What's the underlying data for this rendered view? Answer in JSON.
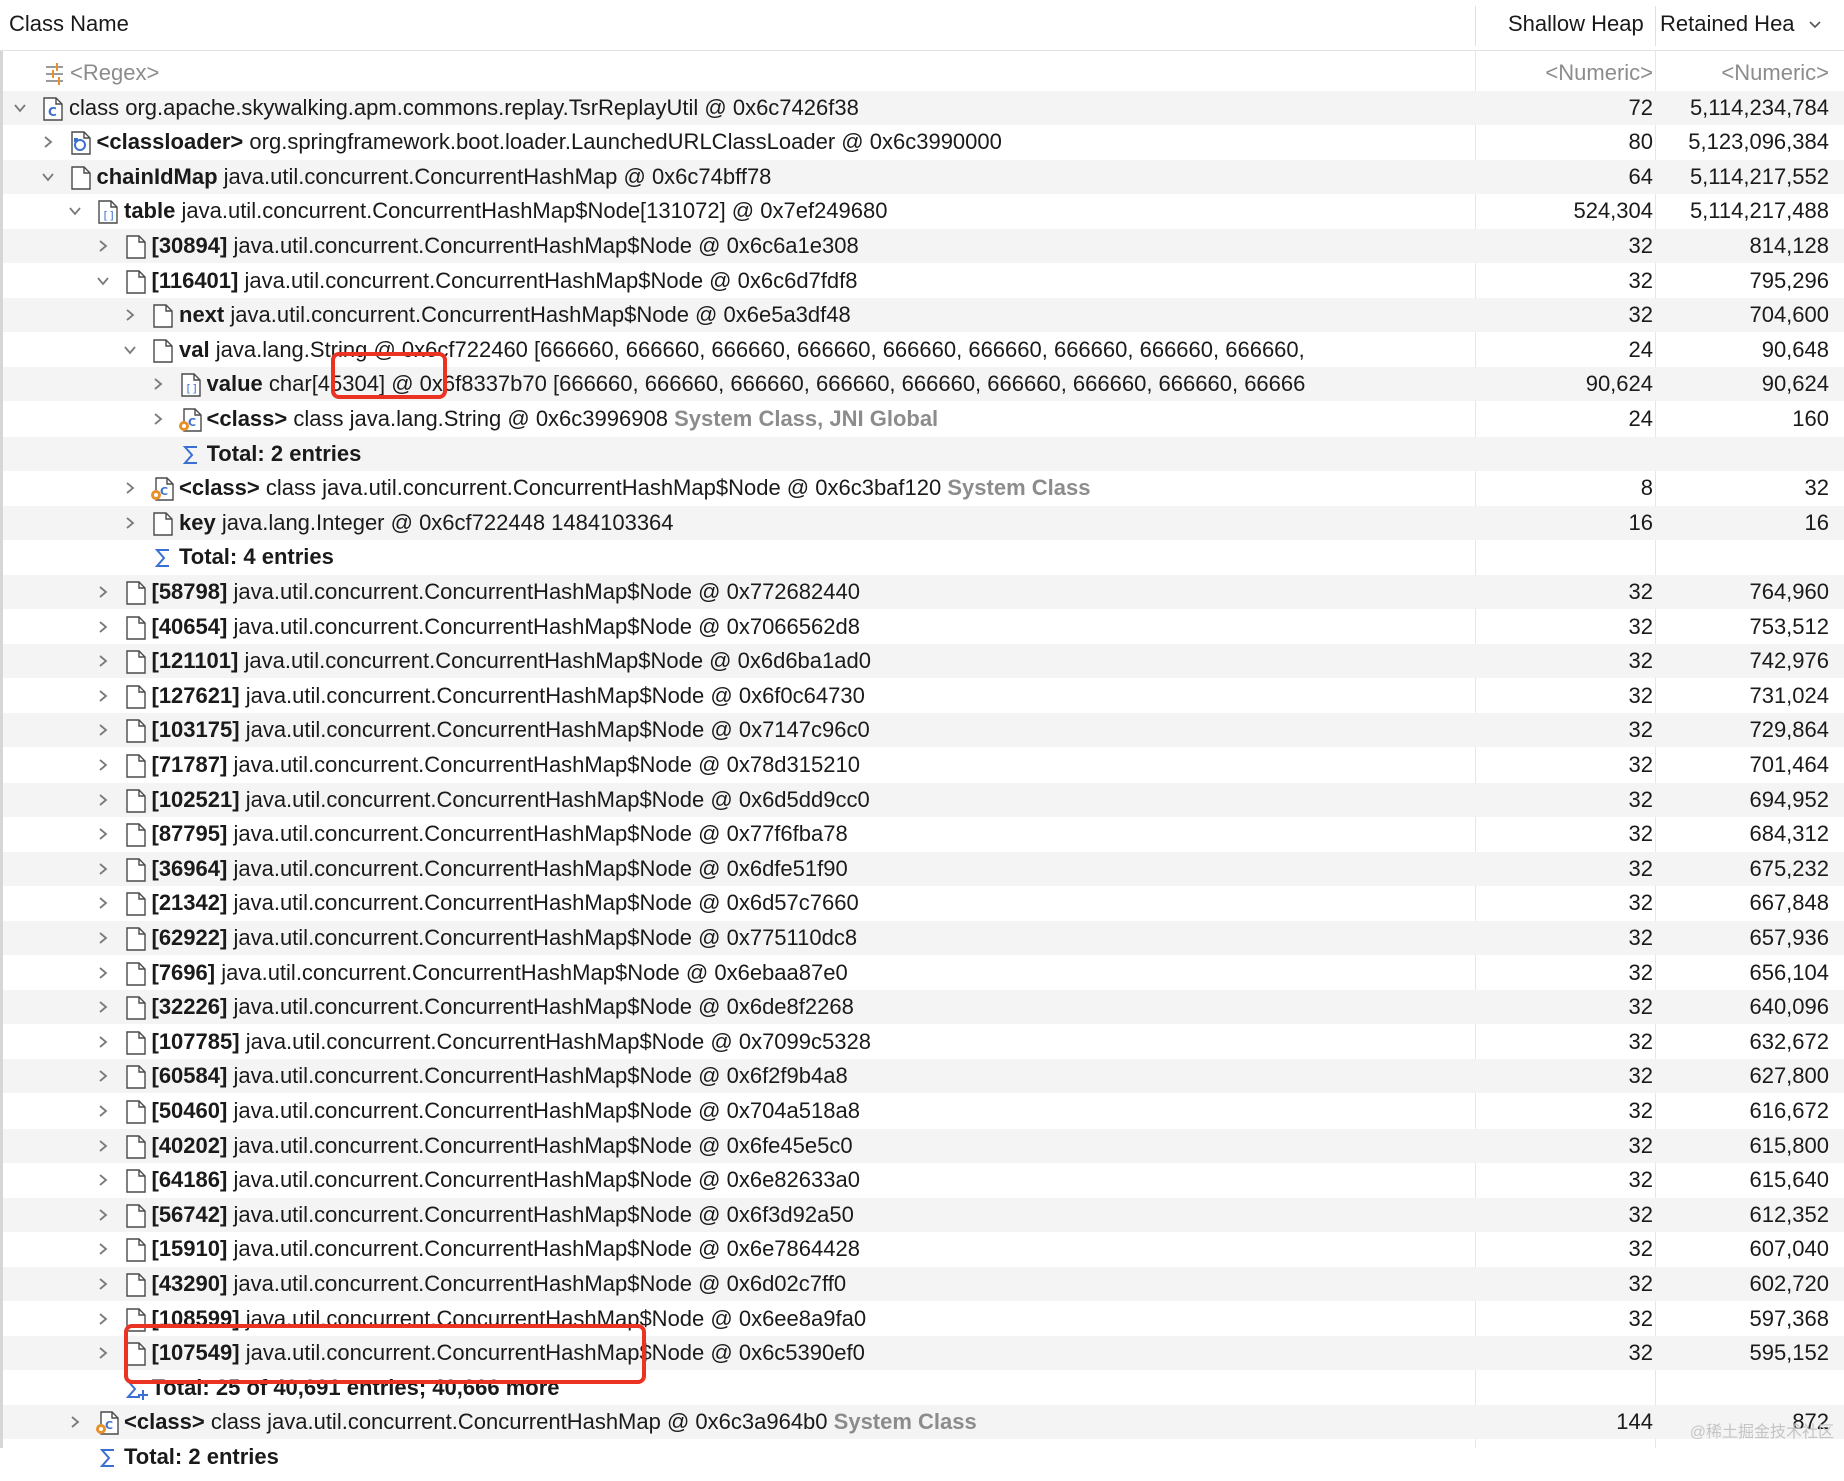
{
  "header": {
    "col_class": "Class Name",
    "col_shallow": "Shallow Heap",
    "col_retained": "Retained Hea"
  },
  "rows": [
    {
      "type": "regex",
      "text": "<Regex>",
      "shallow": "<Numeric>",
      "retained": "<Numeric>"
    },
    {
      "indent": 0,
      "twisty": "down",
      "icon": "class",
      "bold": "",
      "text": "class org.apache.skywalking.apm.commons.replay.TsrReplayUtil @ 0x6c7426f38",
      "gray": "",
      "shallow": "72",
      "retained": "5,114,234,784"
    },
    {
      "indent": 1,
      "twisty": "right",
      "icon": "classloader",
      "bold": "<classloader>",
      "text": "org.springframework.boot.loader.LaunchedURLClassLoader @ 0x6c3990000",
      "gray": "",
      "shallow": "80",
      "retained": "5,123,096,384"
    },
    {
      "indent": 1,
      "twisty": "down",
      "icon": "object",
      "bold": "chainIdMap",
      "text": "java.util.concurrent.ConcurrentHashMap @ 0x6c74bff78",
      "gray": "",
      "shallow": "64",
      "retained": "5,114,217,552"
    },
    {
      "indent": 2,
      "twisty": "down",
      "icon": "array",
      "bold": "table",
      "text": "java.util.concurrent.ConcurrentHashMap$Node[131072] @ 0x7ef249680",
      "gray": "",
      "shallow": "524,304",
      "retained": "5,114,217,488"
    },
    {
      "indent": 3,
      "twisty": "right",
      "icon": "object",
      "bold": "[30894]",
      "text": "java.util.concurrent.ConcurrentHashMap$Node @ 0x6c6a1e308",
      "gray": "",
      "shallow": "32",
      "retained": "814,128"
    },
    {
      "indent": 3,
      "twisty": "down",
      "icon": "object",
      "bold": "[116401]",
      "text": "java.util.concurrent.ConcurrentHashMap$Node @ 0x6c6d7fdf8",
      "gray": "",
      "shallow": "32",
      "retained": "795,296"
    },
    {
      "indent": 4,
      "twisty": "right",
      "icon": "object",
      "bold": "next",
      "text": "java.util.concurrent.ConcurrentHashMap$Node @ 0x6e5a3df48",
      "gray": "",
      "shallow": "32",
      "retained": "704,600"
    },
    {
      "indent": 4,
      "twisty": "down",
      "icon": "object",
      "bold": "val",
      "text": "java.lang.String @ 0x6cf722460  [666660, 666660, 666660, 666660, 666660, 666660, 666660, 666660, 666660,",
      "gray": "",
      "shallow": "24",
      "retained": "90,648"
    },
    {
      "indent": 5,
      "twisty": "right",
      "icon": "array",
      "bold": "value",
      "text": "char[45304] @ 0x6f8337b70  [666660, 666660, 666660, 666660, 666660, 666660, 666660, 666660, 66666",
      "gray": "",
      "shallow": "90,624",
      "retained": "90,624"
    },
    {
      "indent": 5,
      "twisty": "right",
      "icon": "sysclass",
      "bold": "<class>",
      "text": "class java.lang.String @ 0x6c3996908",
      "gray": "System Class, JNI Global",
      "shallow": "24",
      "retained": "160"
    },
    {
      "indent": 5,
      "twisty": "none",
      "icon": "sigma",
      "bold": "Total: 2 entries",
      "text": "",
      "gray": "",
      "shallow": "",
      "retained": ""
    },
    {
      "indent": 4,
      "twisty": "right",
      "icon": "sysclass",
      "bold": "<class>",
      "text": "class java.util.concurrent.ConcurrentHashMap$Node @ 0x6c3baf120",
      "gray": "System Class",
      "shallow": "8",
      "retained": "32"
    },
    {
      "indent": 4,
      "twisty": "right",
      "icon": "object",
      "bold": "key",
      "text": "java.lang.Integer @ 0x6cf722448  1484103364",
      "gray": "",
      "shallow": "16",
      "retained": "16"
    },
    {
      "indent": 4,
      "twisty": "none",
      "icon": "sigma",
      "bold": "Total: 4 entries",
      "text": "",
      "gray": "",
      "shallow": "",
      "retained": ""
    },
    {
      "indent": 3,
      "twisty": "right",
      "icon": "object",
      "bold": "[58798]",
      "text": "java.util.concurrent.ConcurrentHashMap$Node @ 0x772682440",
      "gray": "",
      "shallow": "32",
      "retained": "764,960"
    },
    {
      "indent": 3,
      "twisty": "right",
      "icon": "object",
      "bold": "[40654]",
      "text": "java.util.concurrent.ConcurrentHashMap$Node @ 0x7066562d8",
      "gray": "",
      "shallow": "32",
      "retained": "753,512"
    },
    {
      "indent": 3,
      "twisty": "right",
      "icon": "object",
      "bold": "[121101]",
      "text": "java.util.concurrent.ConcurrentHashMap$Node @ 0x6d6ba1ad0",
      "gray": "",
      "shallow": "32",
      "retained": "742,976"
    },
    {
      "indent": 3,
      "twisty": "right",
      "icon": "object",
      "bold": "[127621]",
      "text": "java.util.concurrent.ConcurrentHashMap$Node @ 0x6f0c64730",
      "gray": "",
      "shallow": "32",
      "retained": "731,024"
    },
    {
      "indent": 3,
      "twisty": "right",
      "icon": "object",
      "bold": "[103175]",
      "text": "java.util.concurrent.ConcurrentHashMap$Node @ 0x7147c96c0",
      "gray": "",
      "shallow": "32",
      "retained": "729,864"
    },
    {
      "indent": 3,
      "twisty": "right",
      "icon": "object",
      "bold": "[71787]",
      "text": "java.util.concurrent.ConcurrentHashMap$Node @ 0x78d315210",
      "gray": "",
      "shallow": "32",
      "retained": "701,464"
    },
    {
      "indent": 3,
      "twisty": "right",
      "icon": "object",
      "bold": "[102521]",
      "text": "java.util.concurrent.ConcurrentHashMap$Node @ 0x6d5dd9cc0",
      "gray": "",
      "shallow": "32",
      "retained": "694,952"
    },
    {
      "indent": 3,
      "twisty": "right",
      "icon": "object",
      "bold": "[87795]",
      "text": "java.util.concurrent.ConcurrentHashMap$Node @ 0x77f6fba78",
      "gray": "",
      "shallow": "32",
      "retained": "684,312"
    },
    {
      "indent": 3,
      "twisty": "right",
      "icon": "object",
      "bold": "[36964]",
      "text": "java.util.concurrent.ConcurrentHashMap$Node @ 0x6dfe51f90",
      "gray": "",
      "shallow": "32",
      "retained": "675,232"
    },
    {
      "indent": 3,
      "twisty": "right",
      "icon": "object",
      "bold": "[21342]",
      "text": "java.util.concurrent.ConcurrentHashMap$Node @ 0x6d57c7660",
      "gray": "",
      "shallow": "32",
      "retained": "667,848"
    },
    {
      "indent": 3,
      "twisty": "right",
      "icon": "object",
      "bold": "[62922]",
      "text": "java.util.concurrent.ConcurrentHashMap$Node @ 0x775110dc8",
      "gray": "",
      "shallow": "32",
      "retained": "657,936"
    },
    {
      "indent": 3,
      "twisty": "right",
      "icon": "object",
      "bold": "[7696]",
      "text": "java.util.concurrent.ConcurrentHashMap$Node @ 0x6ebaa87e0",
      "gray": "",
      "shallow": "32",
      "retained": "656,104"
    },
    {
      "indent": 3,
      "twisty": "right",
      "icon": "object",
      "bold": "[32226]",
      "text": "java.util.concurrent.ConcurrentHashMap$Node @ 0x6de8f2268",
      "gray": "",
      "shallow": "32",
      "retained": "640,096"
    },
    {
      "indent": 3,
      "twisty": "right",
      "icon": "object",
      "bold": "[107785]",
      "text": "java.util.concurrent.ConcurrentHashMap$Node @ 0x7099c5328",
      "gray": "",
      "shallow": "32",
      "retained": "632,672"
    },
    {
      "indent": 3,
      "twisty": "right",
      "icon": "object",
      "bold": "[60584]",
      "text": "java.util.concurrent.ConcurrentHashMap$Node @ 0x6f2f9b4a8",
      "gray": "",
      "shallow": "32",
      "retained": "627,800"
    },
    {
      "indent": 3,
      "twisty": "right",
      "icon": "object",
      "bold": "[50460]",
      "text": "java.util.concurrent.ConcurrentHashMap$Node @ 0x704a518a8",
      "gray": "",
      "shallow": "32",
      "retained": "616,672"
    },
    {
      "indent": 3,
      "twisty": "right",
      "icon": "object",
      "bold": "[40202]",
      "text": "java.util.concurrent.ConcurrentHashMap$Node @ 0x6fe45e5c0",
      "gray": "",
      "shallow": "32",
      "retained": "615,800"
    },
    {
      "indent": 3,
      "twisty": "right",
      "icon": "object",
      "bold": "[64186]",
      "text": "java.util.concurrent.ConcurrentHashMap$Node @ 0x6e82633a0",
      "gray": "",
      "shallow": "32",
      "retained": "615,640"
    },
    {
      "indent": 3,
      "twisty": "right",
      "icon": "object",
      "bold": "[56742]",
      "text": "java.util.concurrent.ConcurrentHashMap$Node @ 0x6f3d92a50",
      "gray": "",
      "shallow": "32",
      "retained": "612,352"
    },
    {
      "indent": 3,
      "twisty": "right",
      "icon": "object",
      "bold": "[15910]",
      "text": "java.util.concurrent.ConcurrentHashMap$Node @ 0x6e7864428",
      "gray": "",
      "shallow": "32",
      "retained": "607,040"
    },
    {
      "indent": 3,
      "twisty": "right",
      "icon": "object",
      "bold": "[43290]",
      "text": "java.util.concurrent.ConcurrentHashMap$Node @ 0x6d02c7ff0",
      "gray": "",
      "shallow": "32",
      "retained": "602,720"
    },
    {
      "indent": 3,
      "twisty": "right",
      "icon": "object",
      "bold": "[108599]",
      "text": "java.util.concurrent.ConcurrentHashMap$Node @ 0x6ee8a9fa0",
      "gray": "",
      "shallow": "32",
      "retained": "597,368"
    },
    {
      "indent": 3,
      "twisty": "right",
      "icon": "object",
      "bold": "[107549]",
      "text": "java.util.concurrent.ConcurrentHashMap$Node @ 0x6c5390ef0",
      "gray": "",
      "shallow": "32",
      "retained": "595,152"
    },
    {
      "indent": 3,
      "twisty": "none",
      "icon": "sigma-more",
      "bold": "Total: 25 of 40,691 entries; 40,666 more",
      "text": "",
      "gray": "",
      "shallow": "",
      "retained": ""
    },
    {
      "indent": 2,
      "twisty": "right",
      "icon": "sysclass",
      "bold": "<class>",
      "text": "class java.util.concurrent.ConcurrentHashMap @ 0x6c3a964b0",
      "gray": "System Class",
      "shallow": "144",
      "retained": "872"
    },
    {
      "indent": 2,
      "twisty": "none",
      "icon": "sigma",
      "bold": "Total: 2 entries",
      "text": "",
      "gray": "",
      "shallow": "",
      "retained": ""
    }
  ],
  "watermark": "@稀土掘金技术社区",
  "colors": {
    "highlight": "#ea3323",
    "row_alt": "#f4f4f4",
    "icon_blue": "#3b6fd1",
    "icon_orange": "#e8902a"
  }
}
